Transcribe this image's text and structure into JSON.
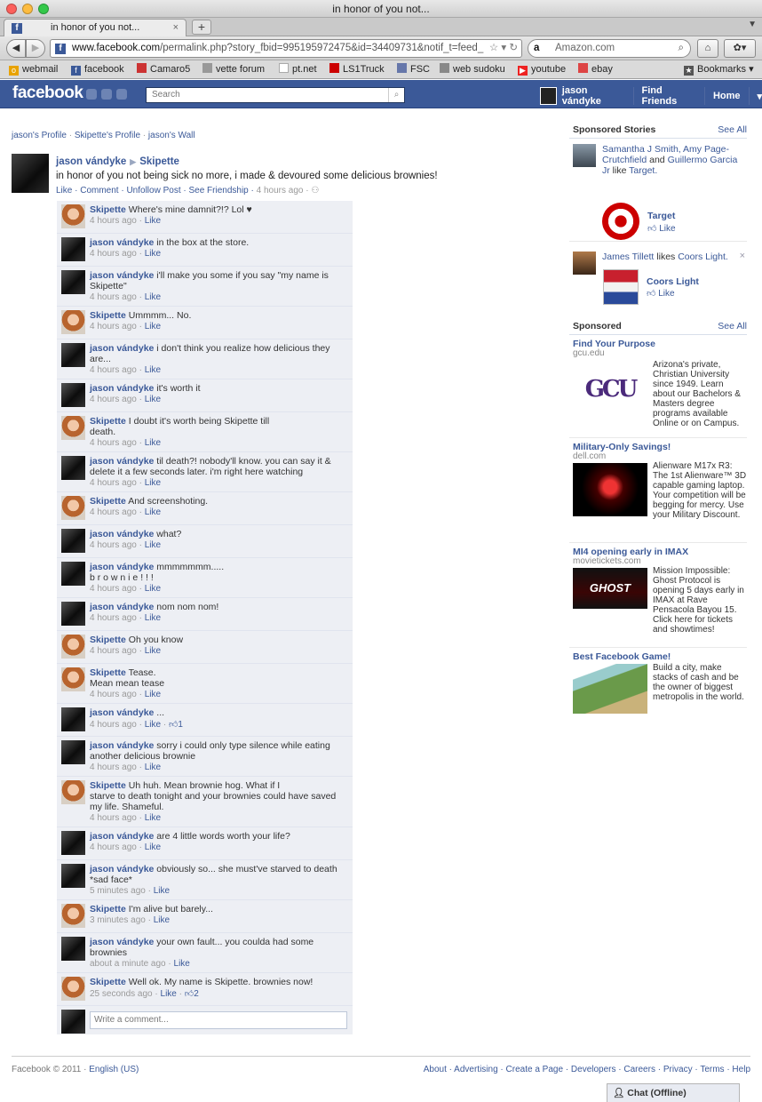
{
  "window": {
    "title": "in honor of you not..."
  },
  "tab": {
    "title": "in honor of you not...",
    "close": "×",
    "new": "+"
  },
  "nav": {
    "url_domain": "www.facebook.com",
    "url_path": "/permalink.php?story_fbid=995195972475&id=34409731&notif_t=feed_",
    "search_engine": "a",
    "search_placeholder": "Amazon.com"
  },
  "bookmarks": [
    {
      "label": "webmail",
      "color": "#e8a200"
    },
    {
      "label": "facebook",
      "color": "#3b5998"
    },
    {
      "label": "Camaro5",
      "color": "#c33"
    },
    {
      "label": "vette forum",
      "color": "#999"
    },
    {
      "label": "pt.net",
      "color": "#bbb"
    },
    {
      "label": "LS1Truck",
      "color": "#c00"
    },
    {
      "label": "FSC",
      "color": "#67a"
    },
    {
      "label": "web sudoku",
      "color": "#888"
    },
    {
      "label": "youtube",
      "color": "#e22"
    },
    {
      "label": "ebay",
      "color": "#d44"
    }
  ],
  "bookmarks_menu": "Bookmarks",
  "fb": {
    "logo": "facebook",
    "search_placeholder": "Search",
    "user": "jason vándyke",
    "find_friends": "Find Friends",
    "home": "Home",
    "brand_color": "#3b5998"
  },
  "breadcrumbs": [
    "jason's Profile",
    "Skipette's Profile",
    "jason's Wall"
  ],
  "post": {
    "author": "jason vándyke",
    "target": "Skipette",
    "text": "in honor of you not being sick no more, i made & devoured some delicious brownies!",
    "actions": "Like · Comment · Unfollow Post · See Friendship · ",
    "time": "4 hours ago ·"
  },
  "comments": [
    {
      "who": "s",
      "author": "Skipette",
      "text": "Where's mine damnit?!? Lol ♥",
      "time": "4 hours ago",
      "likes": ""
    },
    {
      "who": "j",
      "author": "jason vándyke",
      "text": "in the box at the store.",
      "time": "4 hours ago",
      "likes": ""
    },
    {
      "who": "j",
      "author": "jason vándyke",
      "text": "i'll make you some if you say \"my name is\nSkipette\"",
      "time": "4 hours ago",
      "likes": ""
    },
    {
      "who": "s",
      "author": "Skipette",
      "text": "Ummmm... No.",
      "time": "4 hours ago",
      "likes": ""
    },
    {
      "who": "j",
      "author": "jason vándyke",
      "text": "i don't think you realize how delicious they\nare...",
      "time": "4 hours ago",
      "likes": ""
    },
    {
      "who": "j",
      "author": "jason vándyke",
      "text": "it's worth it",
      "time": "4 hours ago",
      "likes": ""
    },
    {
      "who": "s",
      "author": "Skipette",
      "text": "I doubt it's worth being Skipette till\ndeath.",
      "time": "4 hours ago",
      "likes": ""
    },
    {
      "who": "j",
      "author": "jason vándyke",
      "text": "til death?! nobody'll know. you can say it &\ndelete it a few seconds later. i'm right here watching",
      "time": "4 hours ago",
      "likes": ""
    },
    {
      "who": "s",
      "author": "Skipette",
      "text": "And screenshoting.",
      "time": "4 hours ago",
      "likes": ""
    },
    {
      "who": "j",
      "author": "jason vándyke",
      "text": "what?",
      "time": "4 hours ago",
      "likes": ""
    },
    {
      "who": "j",
      "author": "jason vándyke",
      "text": "mmmmmmm.....\nb r o w n i e ! ! !",
      "time": "4 hours ago",
      "likes": ""
    },
    {
      "who": "j",
      "author": "jason vándyke",
      "text": "nom nom nom!",
      "time": "4 hours ago",
      "likes": ""
    },
    {
      "who": "s",
      "author": "Skipette",
      "text": "Oh you know",
      "time": "4 hours ago",
      "likes": ""
    },
    {
      "who": "s",
      "author": "Skipette",
      "text": "Tease.\nMean mean tease",
      "time": "4 hours ago",
      "likes": ""
    },
    {
      "who": "j",
      "author": "jason vándyke",
      "text": "...",
      "time": "4 hours ago",
      "likes": "1"
    },
    {
      "who": "j",
      "author": "jason vándyke",
      "text": "sorry i could only type silence while eating\nanother delicious brownie",
      "time": "4 hours ago",
      "likes": ""
    },
    {
      "who": "s",
      "author": "Skipette",
      "text": "Uh huh. Mean brownie hog. What if I\nstarve to death tonight and your brownies could have saved\nmy life. Shameful.",
      "time": "4 hours ago",
      "likes": ""
    },
    {
      "who": "j",
      "author": "jason vándyke",
      "text": "are 4 little words worth your life?",
      "time": "4 hours ago",
      "likes": ""
    },
    {
      "who": "j",
      "author": "jason vándyke",
      "text": "obviously so... she must've starved to death\n*sad face*",
      "time": "5 minutes ago",
      "likes": ""
    },
    {
      "who": "s",
      "author": "Skipette",
      "text": "I'm alive but barely...",
      "time": "3 minutes ago",
      "likes": ""
    },
    {
      "who": "j",
      "author": "jason vándyke",
      "text": "your own fault... you coulda had some\nbrownies",
      "time": "about a minute ago",
      "likes": ""
    },
    {
      "who": "s",
      "author": "Skipette",
      "text": "Well ok. My name is Skipette. brownies now!",
      "time": "25 seconds ago",
      "likes": "2"
    }
  ],
  "like_label": "Like",
  "write_comment_placeholder": "Write a comment...",
  "sponsored_stories": {
    "heading": "Sponsored Stories",
    "see_all": "See All",
    "story1": {
      "names": "Samantha J Smith, Amy Page-Crutchfield",
      "and": " and ",
      "last": "Guillermo Garcia Jr",
      "likes": " like ",
      "page": "Target.",
      "brand": "Target",
      "like": "Like"
    },
    "story2": {
      "name": "James Tillett",
      "likes": " likes ",
      "page": "Coors Light.",
      "brand": "Coors Light",
      "like": "Like",
      "close": "×"
    }
  },
  "sponsored": {
    "heading": "Sponsored",
    "see_all": "See All",
    "ads": [
      {
        "title": "Find Your Purpose",
        "url": "gcu.edu",
        "body": "Arizona's private, Christian University since 1949. Learn about our Bachelors & Masters degree programs available Online or on Campus.",
        "img": "GCU"
      },
      {
        "title": "Military-Only Savings!",
        "url": "dell.com",
        "body": "Alienware M17x R3: The 1st Alienware™ 3D capable gaming laptop. Your competition will be begging for mercy. Use your Military Discount.",
        "img": ""
      },
      {
        "title": "MI4 opening early in IMAX",
        "url": "movietickets.com",
        "body": "Mission Impossible: Ghost Protocol is opening 5 days early in IMAX at Rave Pensacola Bayou 15. Click here for tickets and showtimes!",
        "img": "GHOST PROTOCOL"
      },
      {
        "title": "Best Facebook Game!",
        "url": "",
        "body": "Build a city, make stacks of cash and be the owner of biggest metropolis in the world.",
        "img": ""
      }
    ]
  },
  "footer": {
    "copyright": "Facebook © 2011 · ",
    "lang": "English (US)",
    "links": "About · Advertising · Create a Page · Developers · Careers · Privacy · Terms · Help"
  },
  "chat": "Chat (Offline)"
}
